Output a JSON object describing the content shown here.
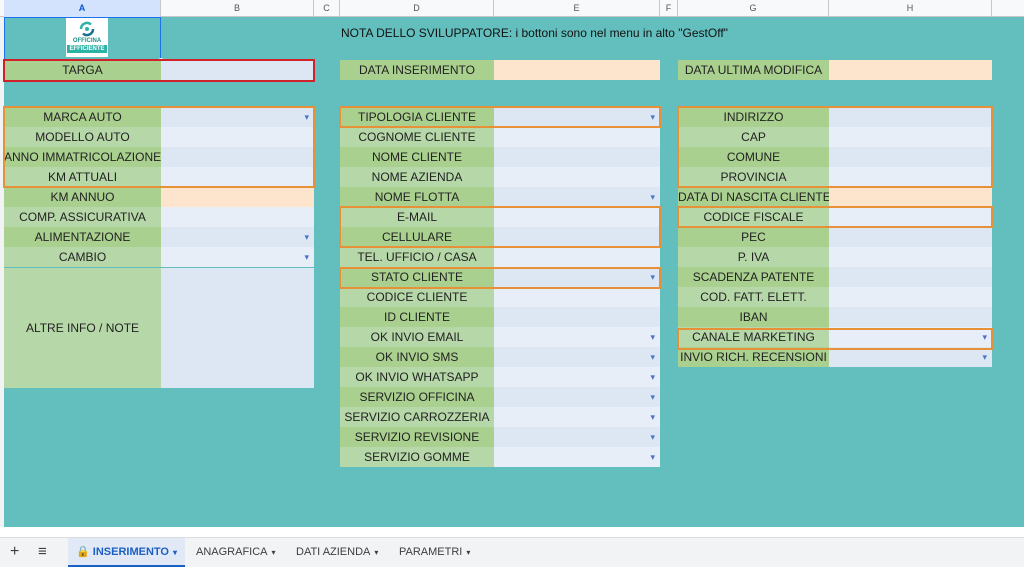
{
  "columns": [
    "A",
    "B",
    "C",
    "D",
    "E",
    "F",
    "G",
    "H"
  ],
  "developer_note": "NOTA DELLO SVILUPPATORE: i bottoni sono nel menu in alto \"GestOff\"",
  "logo": {
    "line1": "OFFICINA",
    "line2": "EFFICIENTE"
  },
  "top_fields": {
    "targa": "TARGA",
    "data_inserimento": "DATA INSERIMENTO",
    "data_ultima_modifica": "DATA ULTIMA MODIFICA"
  },
  "vehicle_fields": [
    "MARCA AUTO",
    "MODELLO AUTO",
    "ANNO IMMATRICOLAZIONE",
    "KM ATTUALI",
    "KM ANNUO",
    "COMP. ASSICURATIVA",
    "ALIMENTAZIONE",
    "CAMBIO"
  ],
  "notes_label": "ALTRE INFO / NOTE",
  "client_fields": [
    "TIPOLOGIA CLIENTE",
    "COGNOME CLIENTE",
    "NOME CLIENTE",
    "NOME AZIENDA",
    "NOME FLOTTA",
    "E-MAIL",
    "CELLULARE",
    "TEL. UFFICIO / CASA",
    "STATO CLIENTE",
    "CODICE CLIENTE",
    "ID CLIENTE",
    "OK INVIO EMAIL",
    "OK INVIO SMS",
    "OK INVIO WHATSAPP",
    "SERVIZIO OFFICINA",
    "SERVIZIO CARROZZERIA",
    "SERVIZIO REVISIONE",
    "SERVIZIO GOMME"
  ],
  "address_fields": [
    "INDIRIZZO",
    "CAP",
    "COMUNE",
    "PROVINCIA",
    "DATA DI NASCITA CLIENTE",
    "CODICE FISCALE",
    "PEC",
    "P. IVA",
    "SCADENZA PATENTE",
    "COD. FATT. ELETT.",
    "IBAN",
    "CANALE MARKETING",
    "INVIO RICH. RECENSIONI"
  ],
  "sheet_tabs": [
    "INSERIMENTO",
    "ANAGRAFICA",
    "DATI AZIENDA",
    "PARAMETRI"
  ],
  "icons": {
    "add": "plus-icon",
    "list": "menu-icon",
    "lock": "lock-icon",
    "dropdown": "chevron-down-icon"
  },
  "colors": {
    "background": "#63bfbd",
    "label_green": "#b6d7a8",
    "value_blue": "#dde7f3",
    "peach": "#fde4cc",
    "orange_border": "#e69138",
    "red_border": "#d0202a",
    "active_tab": "#1a5fc4"
  }
}
